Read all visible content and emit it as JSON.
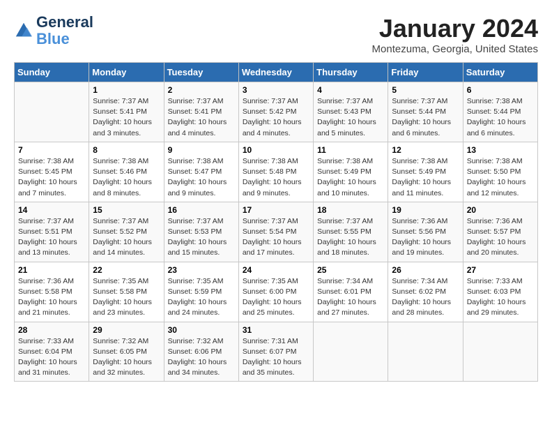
{
  "header": {
    "logo_line1": "General",
    "logo_line2": "Blue",
    "month_title": "January 2024",
    "location": "Montezuma, Georgia, United States"
  },
  "days_of_week": [
    "Sunday",
    "Monday",
    "Tuesday",
    "Wednesday",
    "Thursday",
    "Friday",
    "Saturday"
  ],
  "weeks": [
    [
      {
        "num": "",
        "info": ""
      },
      {
        "num": "1",
        "info": "Sunrise: 7:37 AM\nSunset: 5:41 PM\nDaylight: 10 hours\nand 3 minutes."
      },
      {
        "num": "2",
        "info": "Sunrise: 7:37 AM\nSunset: 5:41 PM\nDaylight: 10 hours\nand 4 minutes."
      },
      {
        "num": "3",
        "info": "Sunrise: 7:37 AM\nSunset: 5:42 PM\nDaylight: 10 hours\nand 4 minutes."
      },
      {
        "num": "4",
        "info": "Sunrise: 7:37 AM\nSunset: 5:43 PM\nDaylight: 10 hours\nand 5 minutes."
      },
      {
        "num": "5",
        "info": "Sunrise: 7:37 AM\nSunset: 5:44 PM\nDaylight: 10 hours\nand 6 minutes."
      },
      {
        "num": "6",
        "info": "Sunrise: 7:38 AM\nSunset: 5:44 PM\nDaylight: 10 hours\nand 6 minutes."
      }
    ],
    [
      {
        "num": "7",
        "info": "Sunrise: 7:38 AM\nSunset: 5:45 PM\nDaylight: 10 hours\nand 7 minutes."
      },
      {
        "num": "8",
        "info": "Sunrise: 7:38 AM\nSunset: 5:46 PM\nDaylight: 10 hours\nand 8 minutes."
      },
      {
        "num": "9",
        "info": "Sunrise: 7:38 AM\nSunset: 5:47 PM\nDaylight: 10 hours\nand 9 minutes."
      },
      {
        "num": "10",
        "info": "Sunrise: 7:38 AM\nSunset: 5:48 PM\nDaylight: 10 hours\nand 9 minutes."
      },
      {
        "num": "11",
        "info": "Sunrise: 7:38 AM\nSunset: 5:49 PM\nDaylight: 10 hours\nand 10 minutes."
      },
      {
        "num": "12",
        "info": "Sunrise: 7:38 AM\nSunset: 5:49 PM\nDaylight: 10 hours\nand 11 minutes."
      },
      {
        "num": "13",
        "info": "Sunrise: 7:38 AM\nSunset: 5:50 PM\nDaylight: 10 hours\nand 12 minutes."
      }
    ],
    [
      {
        "num": "14",
        "info": "Sunrise: 7:37 AM\nSunset: 5:51 PM\nDaylight: 10 hours\nand 13 minutes."
      },
      {
        "num": "15",
        "info": "Sunrise: 7:37 AM\nSunset: 5:52 PM\nDaylight: 10 hours\nand 14 minutes."
      },
      {
        "num": "16",
        "info": "Sunrise: 7:37 AM\nSunset: 5:53 PM\nDaylight: 10 hours\nand 15 minutes."
      },
      {
        "num": "17",
        "info": "Sunrise: 7:37 AM\nSunset: 5:54 PM\nDaylight: 10 hours\nand 17 minutes."
      },
      {
        "num": "18",
        "info": "Sunrise: 7:37 AM\nSunset: 5:55 PM\nDaylight: 10 hours\nand 18 minutes."
      },
      {
        "num": "19",
        "info": "Sunrise: 7:36 AM\nSunset: 5:56 PM\nDaylight: 10 hours\nand 19 minutes."
      },
      {
        "num": "20",
        "info": "Sunrise: 7:36 AM\nSunset: 5:57 PM\nDaylight: 10 hours\nand 20 minutes."
      }
    ],
    [
      {
        "num": "21",
        "info": "Sunrise: 7:36 AM\nSunset: 5:58 PM\nDaylight: 10 hours\nand 21 minutes."
      },
      {
        "num": "22",
        "info": "Sunrise: 7:35 AM\nSunset: 5:58 PM\nDaylight: 10 hours\nand 23 minutes."
      },
      {
        "num": "23",
        "info": "Sunrise: 7:35 AM\nSunset: 5:59 PM\nDaylight: 10 hours\nand 24 minutes."
      },
      {
        "num": "24",
        "info": "Sunrise: 7:35 AM\nSunset: 6:00 PM\nDaylight: 10 hours\nand 25 minutes."
      },
      {
        "num": "25",
        "info": "Sunrise: 7:34 AM\nSunset: 6:01 PM\nDaylight: 10 hours\nand 27 minutes."
      },
      {
        "num": "26",
        "info": "Sunrise: 7:34 AM\nSunset: 6:02 PM\nDaylight: 10 hours\nand 28 minutes."
      },
      {
        "num": "27",
        "info": "Sunrise: 7:33 AM\nSunset: 6:03 PM\nDaylight: 10 hours\nand 29 minutes."
      }
    ],
    [
      {
        "num": "28",
        "info": "Sunrise: 7:33 AM\nSunset: 6:04 PM\nDaylight: 10 hours\nand 31 minutes."
      },
      {
        "num": "29",
        "info": "Sunrise: 7:32 AM\nSunset: 6:05 PM\nDaylight: 10 hours\nand 32 minutes."
      },
      {
        "num": "30",
        "info": "Sunrise: 7:32 AM\nSunset: 6:06 PM\nDaylight: 10 hours\nand 34 minutes."
      },
      {
        "num": "31",
        "info": "Sunrise: 7:31 AM\nSunset: 6:07 PM\nDaylight: 10 hours\nand 35 minutes."
      },
      {
        "num": "",
        "info": ""
      },
      {
        "num": "",
        "info": ""
      },
      {
        "num": "",
        "info": ""
      }
    ]
  ]
}
